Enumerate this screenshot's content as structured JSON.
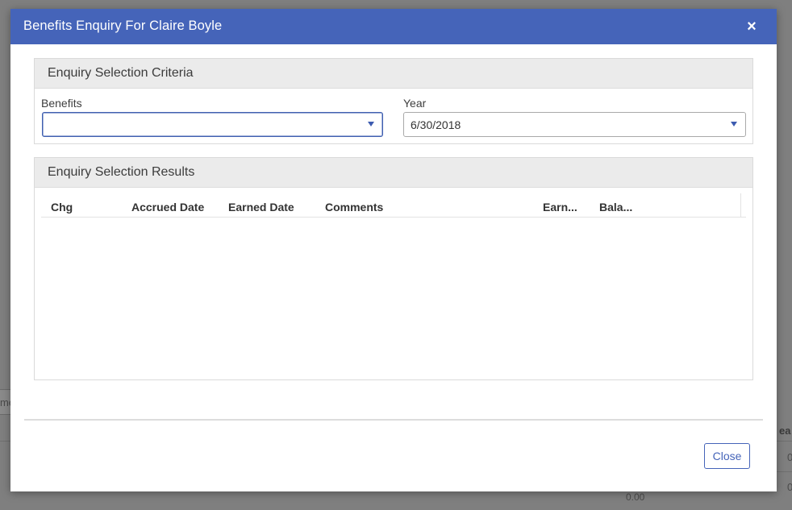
{
  "background": {
    "fragment_left": "me",
    "fragment_right_header": "ea",
    "fragment_right_1": "0",
    "fragment_right_2": "0",
    "fragment_bottom_value": "0.00"
  },
  "modal": {
    "title": "Benefits Enquiry For Claire Boyle",
    "close_icon": "×",
    "criteria": {
      "title": "Enquiry Selection Criteria",
      "benefits_label": "Benefits",
      "benefits_value": "",
      "year_label": "Year",
      "year_value": "6/30/2018"
    },
    "results": {
      "title": "Enquiry Selection Results",
      "columns": [
        "Chg",
        "Accrued Date",
        "Earned Date",
        "Comments",
        "Earn...",
        "Bala..."
      ]
    },
    "close_button_label": "Close"
  },
  "colors": {
    "header": "#4564b9",
    "accent": "#3c5bb0"
  }
}
